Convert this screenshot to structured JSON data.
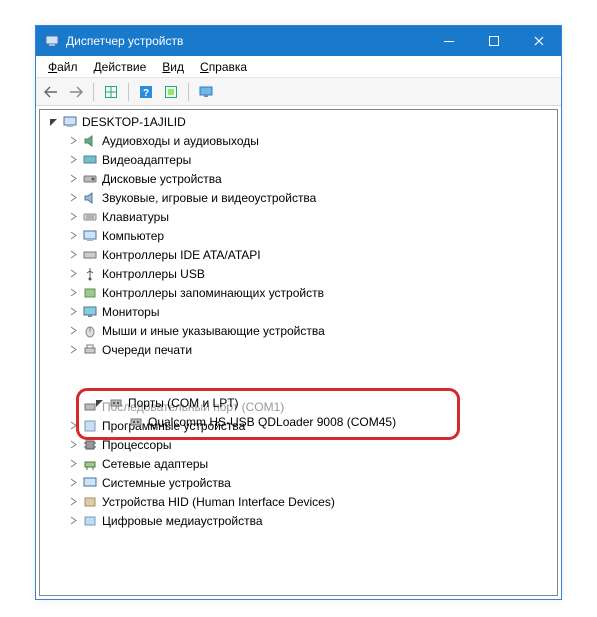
{
  "window": {
    "title": "Диспетчер устройств"
  },
  "menu": {
    "file": "Файл",
    "action": "Действие",
    "view": "Вид",
    "help": "Справка"
  },
  "tree": {
    "root_text": "DESKTOP-1AJILID",
    "categories": [
      "Аудиовходы и аудиовыходы",
      "Видеоадаптеры",
      "Дисковые устройства",
      "Звуковые, игровые и видеоустройства",
      "Клавиатуры",
      "Компьютер",
      "Контроллеры IDE ATA/ATAPI",
      "Контроллеры USB",
      "Контроллеры запоминающих устройств",
      "Мониторы",
      "Мыши и иные указывающие устройства",
      "Очереди печати"
    ],
    "highlight_category": "Порты (COM и LPT)",
    "highlight_child": "Qualcomm HS-USB QDLoader 9008 (COM45)",
    "after_overlap": "Последовательный порт (COM1)",
    "categories_after": [
      "Программные устройства",
      "Процессоры",
      "Сетевые адаптеры",
      "Системные устройства",
      "Устройства HID (Human Interface Devices)",
      "Цифровые медиаустройства"
    ]
  }
}
